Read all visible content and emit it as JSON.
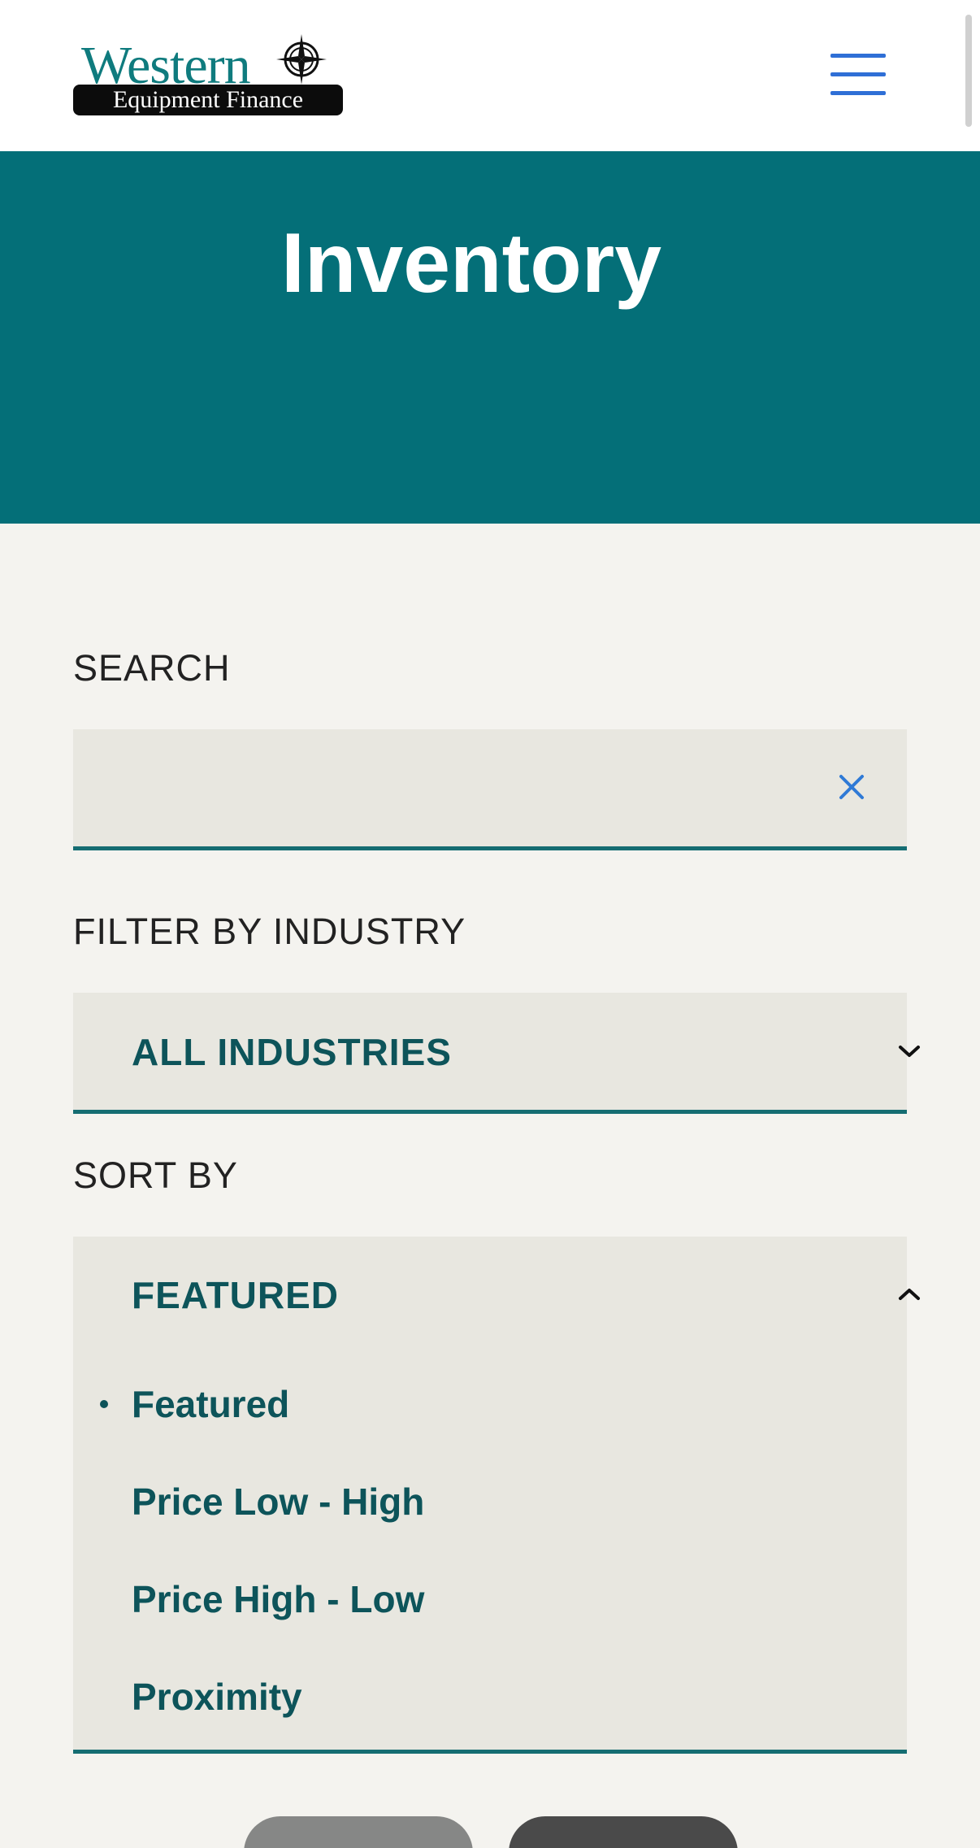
{
  "header": {
    "logo_word": "Western",
    "logo_subtitle": "Equipment Finance",
    "menu_icon": "hamburger-menu-icon"
  },
  "hero": {
    "title": "Inventory"
  },
  "search": {
    "label": "SEARCH",
    "value": "",
    "placeholder": "",
    "clear_icon": "close-icon"
  },
  "industry_filter": {
    "label": "FILTER BY INDUSTRY",
    "selected": "ALL INDUSTRIES",
    "icon": "chevron-down-icon"
  },
  "sort": {
    "label": "SORT BY",
    "selected": "FEATURED",
    "icon": "chevron-up-icon",
    "options": [
      "Featured",
      "Price Low - High",
      "Price High - Low",
      "Proximity"
    ],
    "active_index": 0
  },
  "colors": {
    "brand_teal": "#046f78",
    "text_teal": "#0d545a",
    "accent_blue": "#2f6fd6",
    "page_bg": "#f4f3ef",
    "field_bg": "#e8e7e0"
  }
}
